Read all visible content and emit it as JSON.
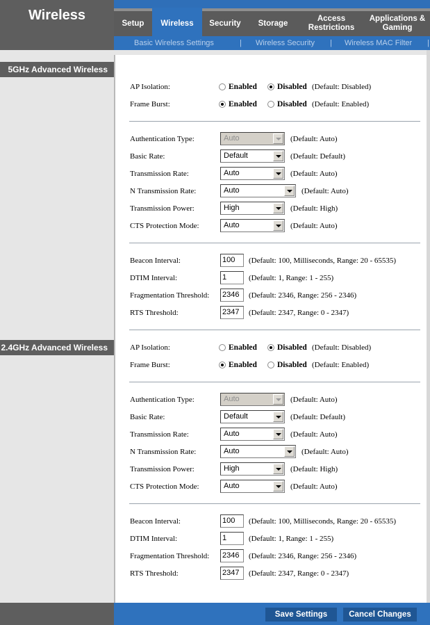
{
  "header": {
    "page_title": "Wireless",
    "tabs": [
      {
        "label": "Setup",
        "active": false
      },
      {
        "label": "Wireless",
        "active": true
      },
      {
        "label": "Security",
        "active": false
      },
      {
        "label": "Storage",
        "active": false
      },
      {
        "label": "Access Restrictions",
        "active": false
      },
      {
        "label": "Applications & Gaming",
        "active": false
      }
    ],
    "subnav": [
      {
        "label": "Basic Wireless Settings"
      },
      {
        "label": "Wireless Security"
      },
      {
        "label": "Wireless MAC Filter"
      }
    ],
    "subnav_separator": "|"
  },
  "sections": [
    {
      "title": "5GHz Advanced Wireless",
      "ap_isolation": {
        "label": "AP Isolation:",
        "selected": "Disabled",
        "hint": "(Default: Disabled)"
      },
      "frame_burst": {
        "label": "Frame Burst:",
        "selected": "Enabled",
        "hint": "(Default: Enabled)"
      },
      "selects": [
        {
          "label": "Authentication Type:",
          "value": "Auto",
          "hint": "(Default: Auto)",
          "disabled": true
        },
        {
          "label": "Basic Rate:",
          "value": "Default",
          "hint": "(Default: Default)",
          "disabled": false
        },
        {
          "label": "Transmission Rate:",
          "value": "Auto",
          "hint": "(Default: Auto)",
          "disabled": false
        },
        {
          "label": "N Transmission Rate:",
          "value": "Auto",
          "hint": "(Default: Auto)",
          "disabled": false
        },
        {
          "label": "Transmission Power:",
          "value": "High",
          "hint": "(Default: High)",
          "disabled": false
        },
        {
          "label": "CTS Protection Mode:",
          "value": "Auto",
          "hint": "(Default: Auto)",
          "disabled": false
        }
      ],
      "inputs": [
        {
          "label": "Beacon Interval:",
          "value": "100",
          "hint": "(Default: 100, Milliseconds, Range: 20 - 65535)"
        },
        {
          "label": "DTIM Interval:",
          "value": "1",
          "hint": "(Default: 1, Range: 1 - 255)"
        },
        {
          "label": "Fragmentation Threshold:",
          "value": "2346",
          "hint": "(Default: 2346, Range: 256 - 2346)"
        },
        {
          "label": "RTS Threshold:",
          "value": "2347",
          "hint": "(Default: 2347, Range: 0 - 2347)"
        }
      ]
    },
    {
      "title": "2.4GHz Advanced Wireless",
      "ap_isolation": {
        "label": "AP Isolation:",
        "selected": "Disabled",
        "hint": "(Default: Disabled)"
      },
      "frame_burst": {
        "label": "Frame Burst:",
        "selected": "Enabled",
        "hint": "(Default: Enabled)"
      },
      "selects": [
        {
          "label": "Authentication Type:",
          "value": "Auto",
          "hint": "(Default: Auto)",
          "disabled": true
        },
        {
          "label": "Basic Rate:",
          "value": "Default",
          "hint": "(Default: Default)",
          "disabled": false
        },
        {
          "label": "Transmission Rate:",
          "value": "Auto",
          "hint": "(Default: Auto)",
          "disabled": false
        },
        {
          "label": "N Transmission Rate:",
          "value": "Auto",
          "hint": "(Default: Auto)",
          "disabled": false
        },
        {
          "label": "Transmission Power:",
          "value": "High",
          "hint": "(Default: High)",
          "disabled": false
        },
        {
          "label": "CTS Protection Mode:",
          "value": "Auto",
          "hint": "(Default: Auto)",
          "disabled": false
        }
      ],
      "inputs": [
        {
          "label": "Beacon Interval:",
          "value": "100",
          "hint": "(Default: 100, Milliseconds, Range: 20 - 65535)"
        },
        {
          "label": "DTIM Interval:",
          "value": "1",
          "hint": "(Default: 1, Range: 1 - 255)"
        },
        {
          "label": "Fragmentation Threshold:",
          "value": "2346",
          "hint": "(Default: 2346, Range: 256 - 2346)"
        },
        {
          "label": "RTS Threshold:",
          "value": "2347",
          "hint": "(Default: 2347, Range: 0 - 2347)"
        }
      ]
    }
  ],
  "radio_labels": {
    "enabled": "Enabled",
    "disabled": "Disabled"
  },
  "footer": {
    "save_label": "Save Settings",
    "cancel_label": "Cancel Changes"
  },
  "colors": {
    "brand_blue": "#2f72bd",
    "header_gray": "#5e5e5e",
    "button_blue": "#1f5694"
  }
}
